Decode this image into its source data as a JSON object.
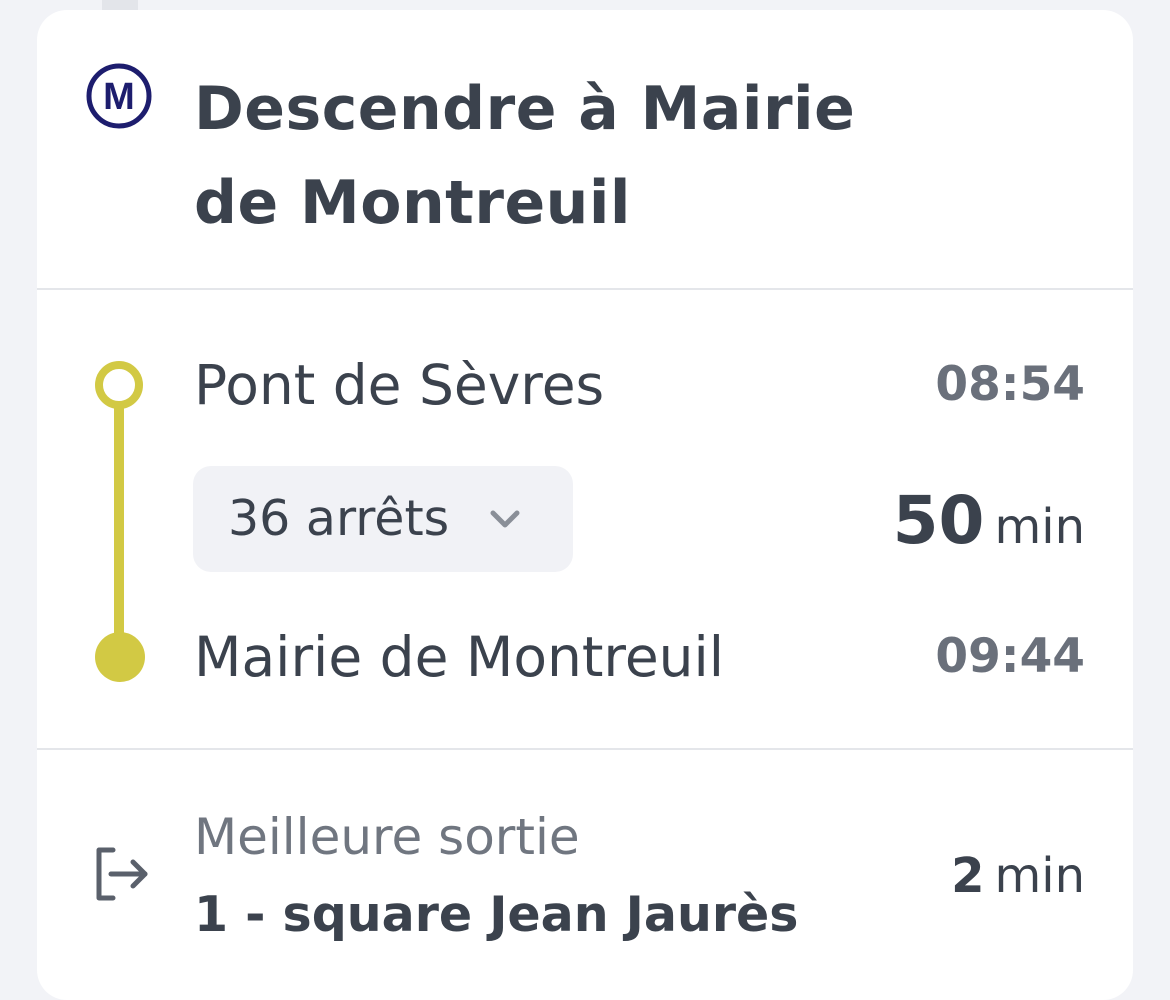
{
  "header": {
    "metro_icon": "metro-m-icon",
    "metro_letter": "M",
    "title": "Descendre à Mairie de Montreuil"
  },
  "segment": {
    "line_color": "#d2c944",
    "departure": {
      "station": "Pont de Sèvres",
      "time": "08:54"
    },
    "stops": {
      "label": "36 arrêts",
      "icon": "chevron-down-icon"
    },
    "duration": {
      "value": "50",
      "unit": "min"
    },
    "arrival": {
      "station": "Mairie de Montreuil",
      "time": "09:44"
    }
  },
  "exit": {
    "icon": "exit-icon",
    "label": "Meilleure sortie",
    "name": "1 - square Jean Jaurès",
    "walk_value": "2",
    "walk_unit": "min"
  },
  "colors": {
    "background": "#f2f3f7",
    "card": "#ffffff",
    "text": "#3b424d",
    "muted": "#6a707b",
    "metro_blue": "#1d1d6e"
  }
}
